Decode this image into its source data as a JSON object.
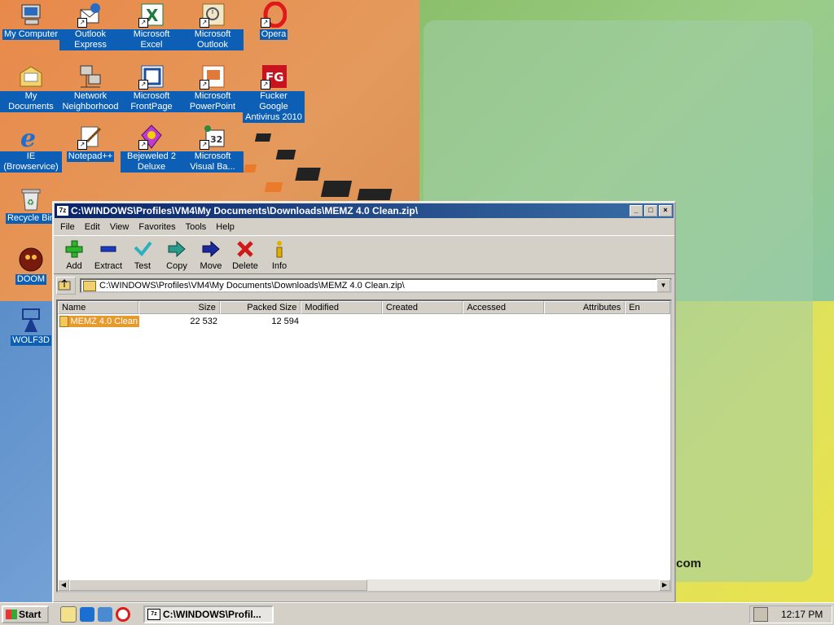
{
  "desktop": {
    "icons": [
      {
        "label": "My Computer"
      },
      {
        "label": "Outlook Express"
      },
      {
        "label": "Microsoft Excel"
      },
      {
        "label": "Microsoft Outlook"
      },
      {
        "label": "Opera"
      },
      {
        "label": "My Documents"
      },
      {
        "label": "Network Neighborhood"
      },
      {
        "label": "Microsoft FrontPage"
      },
      {
        "label": "Microsoft PowerPoint"
      },
      {
        "label": "Fucker Google Antivirus 2010"
      },
      {
        "label": "IE (Browservice)"
      },
      {
        "label": "Notepad++"
      },
      {
        "label": "Bejeweled 2 Deluxe"
      },
      {
        "label": "Microsoft Visual Ba..."
      },
      {
        "label": "Recycle Bin"
      },
      {
        "label": "DOOM"
      },
      {
        "label": "WOLF3D"
      }
    ],
    "wallpaper_text": ".com"
  },
  "window": {
    "title": "C:\\WINDOWS\\Profiles\\VM4\\My Documents\\Downloads\\MEMZ 4.0 Clean.zip\\",
    "app_icon_text": "7z",
    "menu": [
      "File",
      "Edit",
      "View",
      "Favorites",
      "Tools",
      "Help"
    ],
    "toolbar": [
      "Add",
      "Extract",
      "Test",
      "Copy",
      "Move",
      "Delete",
      "Info"
    ],
    "address": "C:\\WINDOWS\\Profiles\\VM4\\My Documents\\Downloads\\MEMZ 4.0 Clean.zip\\",
    "columns": [
      "Name",
      "Size",
      "Packed Size",
      "Modified",
      "Created",
      "Accessed",
      "Attributes",
      "En"
    ],
    "rows": [
      {
        "name": "MEMZ 4.0 Clean",
        "size": "22 532",
        "packed_size": "12 594"
      }
    ]
  },
  "taskbar": {
    "start_label": "Start",
    "task_label": "C:\\WINDOWS\\Profil...",
    "clock": "12:17 PM"
  },
  "colors": {
    "selection": "#e79a2c",
    "titlebar": "#0a246a",
    "icon_label_bg": "#0c5fb4"
  }
}
